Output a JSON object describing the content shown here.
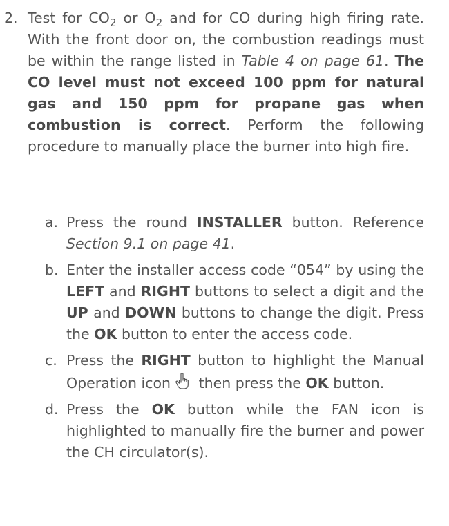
{
  "step": {
    "number": "2.",
    "t_test_for": "Test for CO",
    "t_sub1": "2",
    "t_or": " or O",
    "t_sub2": "2",
    "t_rest1": " and for CO during high firing rate. With the front door on, the combustion readings must be within the range listed in ",
    "t_ref_table": "Table 4 on page 61",
    "t_period": ". ",
    "t_bold": "The CO level must not exceed 100 ppm for natural gas and 150 ppm for propane gas when combustion is correct",
    "t_rest2": ". Perform the following procedure to manually place the burner into high fire."
  },
  "substeps": {
    "a": {
      "letter": "a.",
      "t1": "Press the round ",
      "b1": "INSTALLER",
      "t2": " button. Reference ",
      "ref": "Section 9.1 on page 41",
      "t3": "."
    },
    "b": {
      "letter": "b.",
      "t1": "Enter the installer access code “054” by using the ",
      "b1": "LEFT",
      "t2": " and ",
      "b2": "RIGHT",
      "t3": " buttons to select a digit and the ",
      "b3": "UP",
      "t4": " and ",
      "b4": "DOWN",
      "t5": " buttons to change the digit. Press the ",
      "b5": "OK",
      "t6": " button to enter the access code."
    },
    "c": {
      "letter": "c.",
      "t1": "Press the ",
      "b1": "RIGHT",
      "t2": " button to highlight the Manual Operation icon",
      "icon": "hand-pointer-icon",
      "t3": " then press the ",
      "b2": "OK",
      "t4": " button."
    },
    "d": {
      "letter": "d.",
      "t1": "Press the ",
      "b1": "OK",
      "t2": " button while the FAN icon is highlighted to manually fire the burner and power the CH circulator(s)."
    }
  }
}
